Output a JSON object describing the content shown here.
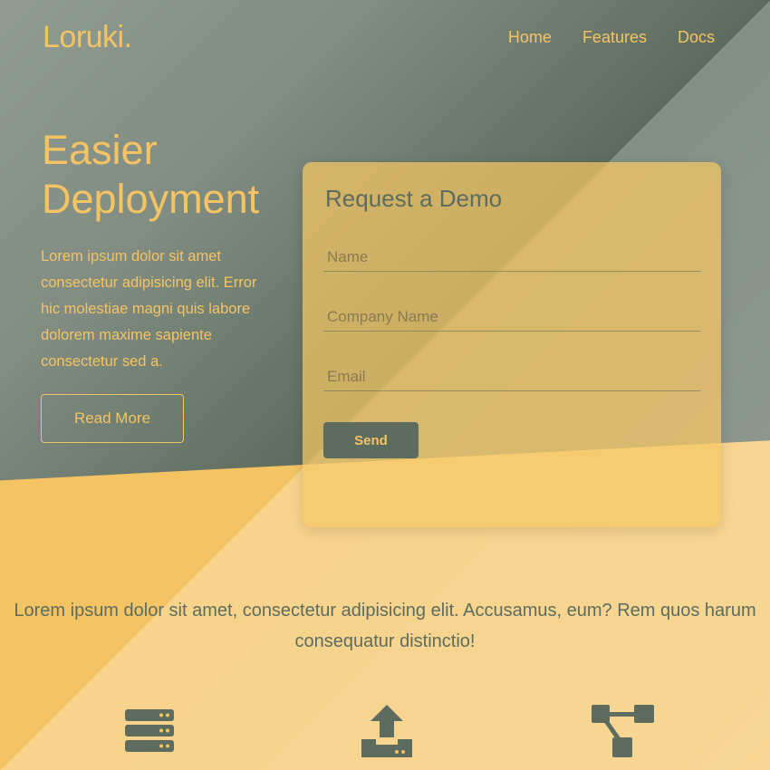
{
  "brand": {
    "logo": "Loruki."
  },
  "nav": {
    "items": [
      "Home",
      "Features",
      "Docs"
    ]
  },
  "hero": {
    "title": "Easier Deployment",
    "text": "Lorem ipsum dolor sit amet consectetur adipisicing elit. Error hic molestiae magni quis labore dolorem maxime sapiente consectetur sed a.",
    "read_more_label": "Read More"
  },
  "demo_form": {
    "title": "Request a Demo",
    "name_placeholder": "Name",
    "company_placeholder": "Company Name",
    "email_placeholder": "Email",
    "send_label": "Send"
  },
  "tagline": "Lorem ipsum dolor sit amet, consectetur adipisicing elit. Accusamus, eum? Rem quos harum consequatur distinctio!",
  "features": {
    "icons": [
      "server-icon",
      "upload-icon",
      "network-icon"
    ]
  },
  "colors": {
    "primary": "#f4c464",
    "dark": "#5d6c5e"
  }
}
